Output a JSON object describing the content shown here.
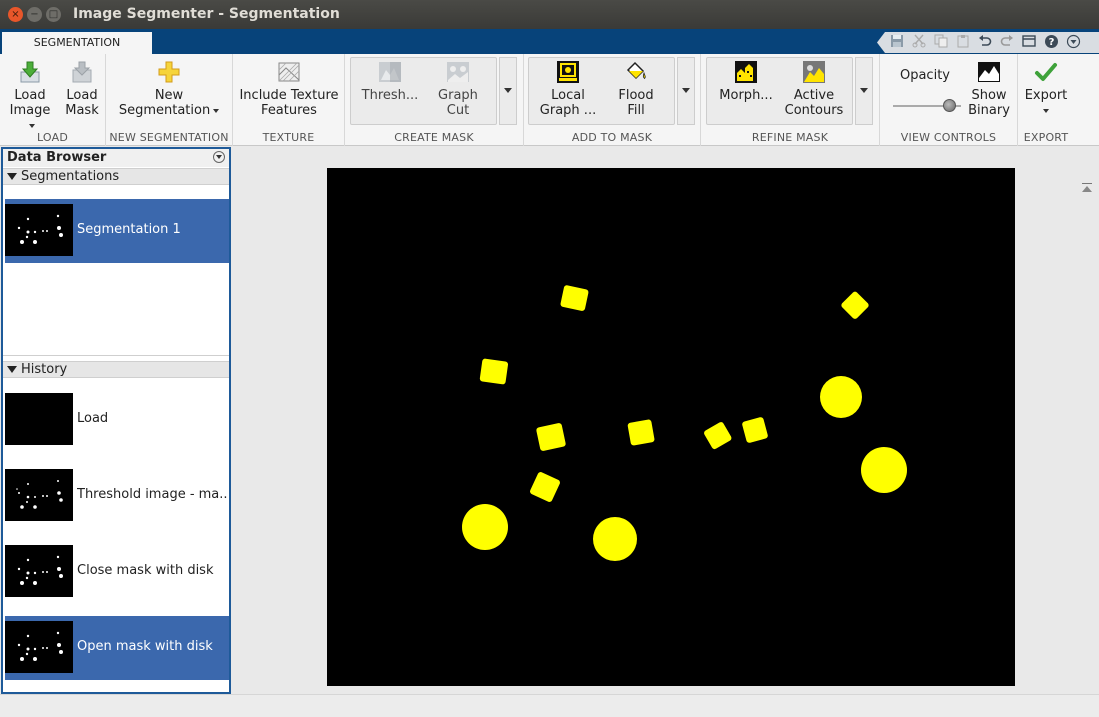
{
  "window": {
    "title": "Image Segmenter - Segmentation",
    "close_glyph": "×",
    "minimize_glyph": "−",
    "maximize_glyph": "□"
  },
  "tabs": [
    {
      "label": "SEGMENTATION",
      "active": true
    }
  ],
  "quick_access": [
    "save-icon",
    "cut-icon",
    "copy-icon",
    "paste-icon",
    "undo-icon",
    "redo-icon",
    "window-icon",
    "help-icon",
    "menu-icon"
  ],
  "toolstrip": {
    "load": {
      "section_label": "LOAD",
      "load_image": "Load",
      "load_image_2": "Image",
      "load_mask": "Load",
      "load_mask_2": "Mask"
    },
    "new_segmentation": {
      "section_label": "NEW SEGMENTATION",
      "button_line1": "New",
      "button_line2": "Segmentation"
    },
    "texture": {
      "section_label": "TEXTURE",
      "button_line1": "Include Texture",
      "button_line2": "Features"
    },
    "create_mask": {
      "section_label": "CREATE MASK",
      "threshold": "Thresh...",
      "graph_cut_1": "Graph",
      "graph_cut_2": "Cut"
    },
    "add_to_mask": {
      "section_label": "ADD TO MASK",
      "local_graph_1": "Local",
      "local_graph_2": "Graph ...",
      "flood_fill_1": "Flood",
      "flood_fill_2": "Fill"
    },
    "refine_mask": {
      "section_label": "REFINE MASK",
      "morph": "Morph...",
      "active_contours_1": "Active",
      "active_contours_2": "Contours"
    },
    "view_controls": {
      "section_label": "VIEW CONTROLS",
      "opacity_label": "Opacity",
      "opacity_value": 0.9,
      "show_binary_1": "Show",
      "show_binary_2": "Binary"
    },
    "export": {
      "section_label": "EXPORT",
      "button": "Export"
    }
  },
  "data_browser": {
    "title": "Data Browser",
    "segmentations_header": "Segmentations",
    "segmentations": [
      {
        "label": "Segmentation 1",
        "selected": true
      }
    ],
    "history_header": "History",
    "history": [
      {
        "label": "Load",
        "selected": false
      },
      {
        "label": "Threshold image - ma...",
        "selected": false
      },
      {
        "label": "Close mask with disk",
        "selected": false
      },
      {
        "label": "Open mask with disk",
        "selected": true
      }
    ]
  },
  "colors": {
    "accent_blue": "#07437a",
    "selection_blue": "#3b68ad",
    "mask_yellow": "#ffff00",
    "canvas_bg": "#000000"
  }
}
